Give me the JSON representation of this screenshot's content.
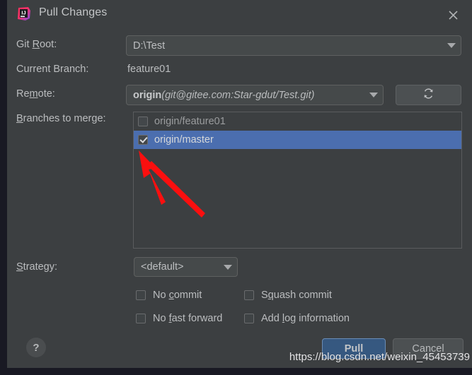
{
  "window": {
    "title": "Pull Changes",
    "app_icon": "intellij-idea-icon",
    "close_icon": "close-icon"
  },
  "form": {
    "git_root": {
      "label_pre": "Git ",
      "label_mnemonic": "R",
      "label_post": "oot:",
      "value": "D:\\Test"
    },
    "current_branch": {
      "label": "Current Branch:",
      "value": "feature01"
    },
    "remote": {
      "label_pre": "Re",
      "label_mnemonic": "m",
      "label_post": "ote:",
      "value_name": "origin",
      "value_url": "(git@gitee.com:Star-gdut/Test.git)",
      "refresh_icon": "refresh-icon"
    },
    "branches_to_merge": {
      "label_pre": "",
      "label_mnemonic": "B",
      "label_post": "ranches to merge:",
      "items": [
        {
          "label": "origin/feature01",
          "checked": false,
          "selected": false
        },
        {
          "label": "origin/master",
          "checked": true,
          "selected": true
        }
      ]
    },
    "strategy": {
      "label_pre": "",
      "label_mnemonic": "S",
      "label_post": "trategy:",
      "value": "<default>"
    },
    "options": [
      {
        "id": "no-commit",
        "pre": "No ",
        "mnemonic": "c",
        "post": "ommit",
        "checked": false
      },
      {
        "id": "no-fast-forward",
        "pre": "No ",
        "mnemonic": "f",
        "post": "ast forward",
        "checked": false
      },
      {
        "id": "squash-commit",
        "pre": "S",
        "mnemonic": "q",
        "post": "uash commit",
        "checked": false
      },
      {
        "id": "add-log-information",
        "pre": "Add ",
        "mnemonic": "l",
        "post": "og information",
        "checked": false
      }
    ]
  },
  "footer": {
    "help_label": "?",
    "pull_label": "Pull",
    "cancel_label": "Cancel"
  },
  "watermark": {
    "text": "https://blog.csdn.net/weixin_45453739"
  },
  "colors": {
    "dialog_bg": "#3c3f41",
    "selection_blue": "#4b6eaf",
    "primary_button": "#365880",
    "annotation_red": "#fb0f0f"
  }
}
